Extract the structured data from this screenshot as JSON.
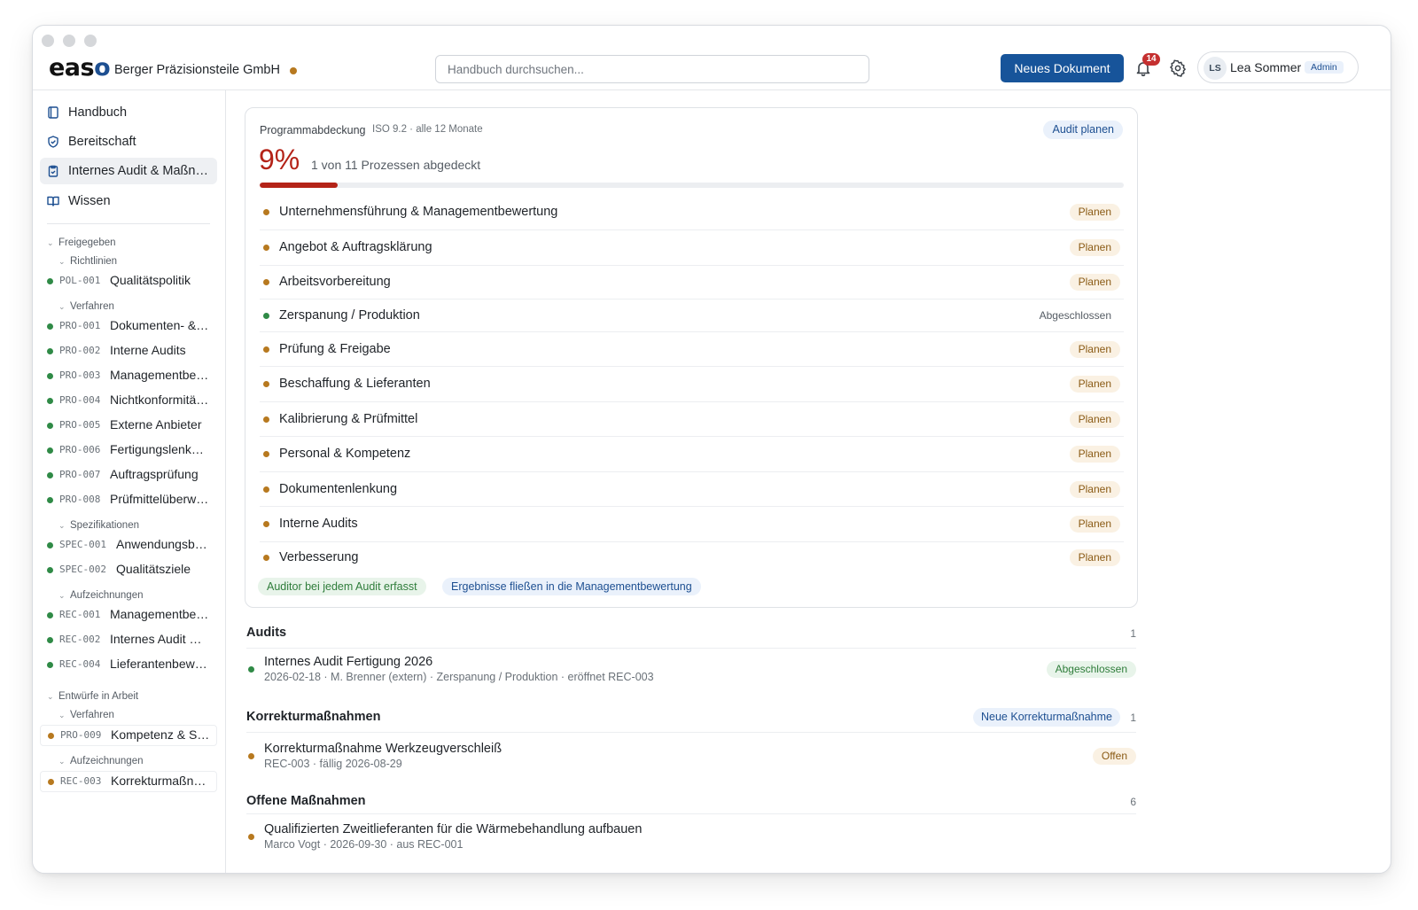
{
  "app": {
    "logo_pre": "eas",
    "logo_o": "o",
    "company": "Berger Präzisionsteile GmbH"
  },
  "header": {
    "search_placeholder": "Handbuch durchsuchen...",
    "new_document": "Neues Dokument",
    "notifications_count": "14",
    "user_initials": "LS",
    "user_name": "Lea Sommer",
    "user_role": "Admin"
  },
  "sidebar": {
    "nav": [
      {
        "label": "Handbuch"
      },
      {
        "label": "Bereitschaft"
      },
      {
        "label": "Internes Audit & Maßnahmen"
      },
      {
        "label": "Wissen"
      }
    ],
    "released_label": "Freigegeben",
    "released_groups": [
      {
        "label": "Richtlinien",
        "docs": [
          {
            "code": "POL-001",
            "name": "Qualitätspolitik"
          }
        ]
      },
      {
        "label": "Verfahren",
        "docs": [
          {
            "code": "PRO-001",
            "name": "Dokumenten- & Aufzeichnungslenkung"
          },
          {
            "code": "PRO-002",
            "name": "Interne Audits"
          },
          {
            "code": "PRO-003",
            "name": "Managementbewertung"
          },
          {
            "code": "PRO-004",
            "name": "Nichtkonformitäten"
          },
          {
            "code": "PRO-005",
            "name": "Externe Anbieter"
          },
          {
            "code": "PRO-006",
            "name": "Fertigungslenkung"
          },
          {
            "code": "PRO-007",
            "name": "Auftragsprüfung"
          },
          {
            "code": "PRO-008",
            "name": "Prüfmittelüberwachung"
          }
        ]
      },
      {
        "label": "Spezifikationen",
        "docs": [
          {
            "code": "SPEC-001",
            "name": "Anwendungsbereich"
          },
          {
            "code": "SPEC-002",
            "name": "Qualitätsziele"
          }
        ]
      },
      {
        "label": "Aufzeichnungen",
        "docs": [
          {
            "code": "REC-001",
            "name": "Managementbewertung"
          },
          {
            "code": "REC-002",
            "name": "Internes Audit Fertigung"
          },
          {
            "code": "REC-004",
            "name": "Lieferantenbewertung"
          }
        ]
      }
    ],
    "drafts_label": "Entwürfe in Arbeit",
    "draft_groups": [
      {
        "label": "Verfahren",
        "docs": [
          {
            "code": "PRO-009",
            "name": "Kompetenz & Schulung"
          }
        ]
      },
      {
        "label": "Aufzeichnungen",
        "docs": [
          {
            "code": "REC-003",
            "name": "Korrekturmaßnahme"
          }
        ]
      }
    ]
  },
  "coverage": {
    "title": "Programmabdeckung",
    "subtitle": "ISO 9.2 · alle 12 Monate",
    "plan_button": "Audit planen",
    "percent_text": "9%",
    "percent_value": 9,
    "note": "1 von 11 Prozessen abgedeckt",
    "processes": [
      {
        "name": "Unternehmensführung & Managementbewertung",
        "status": "Planen"
      },
      {
        "name": "Angebot & Auftragsklärung",
        "status": "Planen"
      },
      {
        "name": "Arbeitsvorbereitung",
        "status": "Planen"
      },
      {
        "name": "Zerspanung / Produktion",
        "status": "Abgeschlossen"
      },
      {
        "name": "Prüfung & Freigabe",
        "status": "Planen"
      },
      {
        "name": "Beschaffung & Lieferanten",
        "status": "Planen"
      },
      {
        "name": "Kalibrierung & Prüfmittel",
        "status": "Planen"
      },
      {
        "name": "Personal & Kompetenz",
        "status": "Planen"
      },
      {
        "name": "Dokumentenlenkung",
        "status": "Planen"
      },
      {
        "name": "Interne Audits",
        "status": "Planen"
      },
      {
        "name": "Verbesserung",
        "status": "Planen"
      }
    ],
    "tags": [
      "Auditor bei jedem Audit erfasst",
      "Ergebnisse fließen in die Managementbewertung"
    ]
  },
  "audits": {
    "title": "Audits",
    "count": "1",
    "items": [
      {
        "title": "Internes Audit Fertigung 2026",
        "meta": "2026-02-18 · M. Brenner (extern) · Zerspanung / Produktion · eröffnet REC-003",
        "status": "Abgeschlossen"
      }
    ]
  },
  "corrective": {
    "title": "Korrekturmaßnahmen",
    "new_button": "Neue Korrekturmaßnahme",
    "count": "1",
    "items": [
      {
        "title": "Korrekturmaßnahme Werkzeugverschleiß",
        "meta": "REC-003 · fällig 2026-08-29",
        "status": "Offen"
      }
    ]
  },
  "open_actions": {
    "title": "Offene Maßnahmen",
    "count": "6",
    "items": [
      {
        "title": "Qualifizierten Zweitlieferanten für die Wärmebehandlung aufbauen",
        "meta": "Marco Vogt · 2026-09-30 · aus REC-001"
      }
    ]
  },
  "colors": {
    "accent": "#17549a",
    "danger": "#b42318",
    "dot_green": "#2f8a46",
    "dot_amber": "#b7791f"
  }
}
